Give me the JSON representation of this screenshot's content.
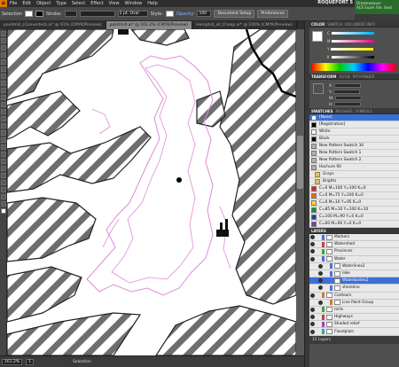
{
  "app": {
    "logo": "Ai",
    "workspace": "ROQUEFORT 5"
  },
  "menu": [
    "File",
    "Edit",
    "Object",
    "Type",
    "Select",
    "Effect",
    "View",
    "Window",
    "Help"
  ],
  "banner": {
    "line1": "Dreamweaver",
    "line2": "ACE Exam File. Sent"
  },
  "control": {
    "selection_label": "Selection",
    "stroke_label": "Stroke:",
    "profile_value": "2 pt. Oval",
    "style_label": "Style:",
    "opacity_label": "Opacity:",
    "opacity_value": "100",
    "doc_setup": "Document Setup",
    "preferences": "Preferences"
  },
  "tabs": [
    {
      "label": "pointmill_(Converted).ai* @ 91% (CMYK/Preview)",
      "active": false
    },
    {
      "label": "pointmill.ai* @ 161.2% (CMYK/Preview)",
      "active": true
    },
    {
      "label": "Hemphill_all_Cheap.ai* @ 100% (CMYK/Preview)",
      "active": false
    }
  ],
  "status": {
    "zoom": "161.2%",
    "page": "1",
    "tool": "Selection"
  },
  "color_panel": {
    "tabs": [
      "COLOR",
      "SWATCH",
      "DOCUMENT INFO"
    ],
    "rows": [
      "C",
      "M",
      "Y",
      "K"
    ]
  },
  "transform_panel": {
    "tabs": [
      "TRANSFORM",
      "ALIGN",
      "PATHFINDER"
    ],
    "rows": [
      "X:",
      "Y:",
      "W:",
      "H:"
    ]
  },
  "swatches_panel": {
    "tabs": [
      "SWATCHES",
      "BRUSHES",
      "SYMBOLS"
    ],
    "items": [
      {
        "name": "[None]",
        "color": "#ffffff",
        "selected": true,
        "group": false
      },
      {
        "name": "[Registration]",
        "color": "#000000",
        "selected": false,
        "group": false
      },
      {
        "name": "White",
        "color": "#ffffff",
        "selected": false,
        "group": false
      },
      {
        "name": "Black",
        "color": "#000000",
        "selected": false,
        "group": false
      },
      {
        "name": "New Pattern Swatch 34",
        "color": "#b0b0b0",
        "selected": false,
        "group": false
      },
      {
        "name": "New Pattern Swatch 1",
        "color": "#b0b0b0",
        "selected": false,
        "group": false
      },
      {
        "name": "New Pattern Swatch 2",
        "color": "#b0b0b0",
        "selected": false,
        "group": false
      },
      {
        "name": "Hachure 90",
        "color": "#b0b0b0",
        "selected": false,
        "group": false
      },
      {
        "name": "Grays",
        "color": "#d9c36a",
        "selected": false,
        "group": true
      },
      {
        "name": "Brights",
        "color": "#d9c36a",
        "selected": false,
        "group": true
      },
      {
        "name": "C=0 M=100 Y=100 K=0",
        "color": "#e41e26",
        "selected": false,
        "group": false
      },
      {
        "name": "C=0 M=75 Y=100 K=0",
        "color": "#f26522",
        "selected": false,
        "group": false
      },
      {
        "name": "C=0 M=10 Y=95 K=0",
        "color": "#ffde17",
        "selected": false,
        "group": false
      },
      {
        "name": "C=85 M=10 Y=100 K=10",
        "color": "#00963f",
        "selected": false,
        "group": false
      },
      {
        "name": "C=100 M=90 Y=0 K=0",
        "color": "#21409a",
        "selected": false,
        "group": false
      },
      {
        "name": "C=60 M=90 Y=0 K=0",
        "color": "#7f3f98",
        "selected": false,
        "group": false
      }
    ]
  },
  "layers_panel": {
    "tabs": [
      "LAYERS"
    ],
    "items": [
      {
        "name": "Markers",
        "color": "#4f6fd6",
        "selected": false,
        "sub": false
      },
      {
        "name": "Watershed",
        "color": "#c04040",
        "selected": false,
        "sub": false
      },
      {
        "name": "Provinces",
        "color": "#40a040",
        "selected": false,
        "sub": false
      },
      {
        "name": "Water",
        "color": "#4f6fd6",
        "selected": false,
        "sub": false
      },
      {
        "name": "Waterlines2",
        "color": "#4f6fd6",
        "selected": false,
        "sub": true
      },
      {
        "name": "lake",
        "color": "#4f6fd6",
        "selected": false,
        "sub": true
      },
      {
        "name": "Waterbodies2",
        "color": "#4f6fd6",
        "selected": true,
        "sub": true
      },
      {
        "name": "shoreline",
        "color": "#4f6fd6",
        "selected": false,
        "sub": true
      },
      {
        "name": "Contours",
        "color": "#c08040",
        "selected": false,
        "sub": false
      },
      {
        "name": "Live Paint Group",
        "color": "#c08040",
        "selected": false,
        "sub": true
      },
      {
        "name": "mills",
        "color": "#40a040",
        "selected": false,
        "sub": false
      },
      {
        "name": "Highways",
        "color": "#c04040",
        "selected": false,
        "sub": false
      },
      {
        "name": "Shaded relief",
        "color": "#a040c0",
        "selected": false,
        "sub": false
      },
      {
        "name": "Floodplain",
        "color": "#40a0a0",
        "selected": false,
        "sub": false
      }
    ],
    "footer": "15 Layers"
  }
}
